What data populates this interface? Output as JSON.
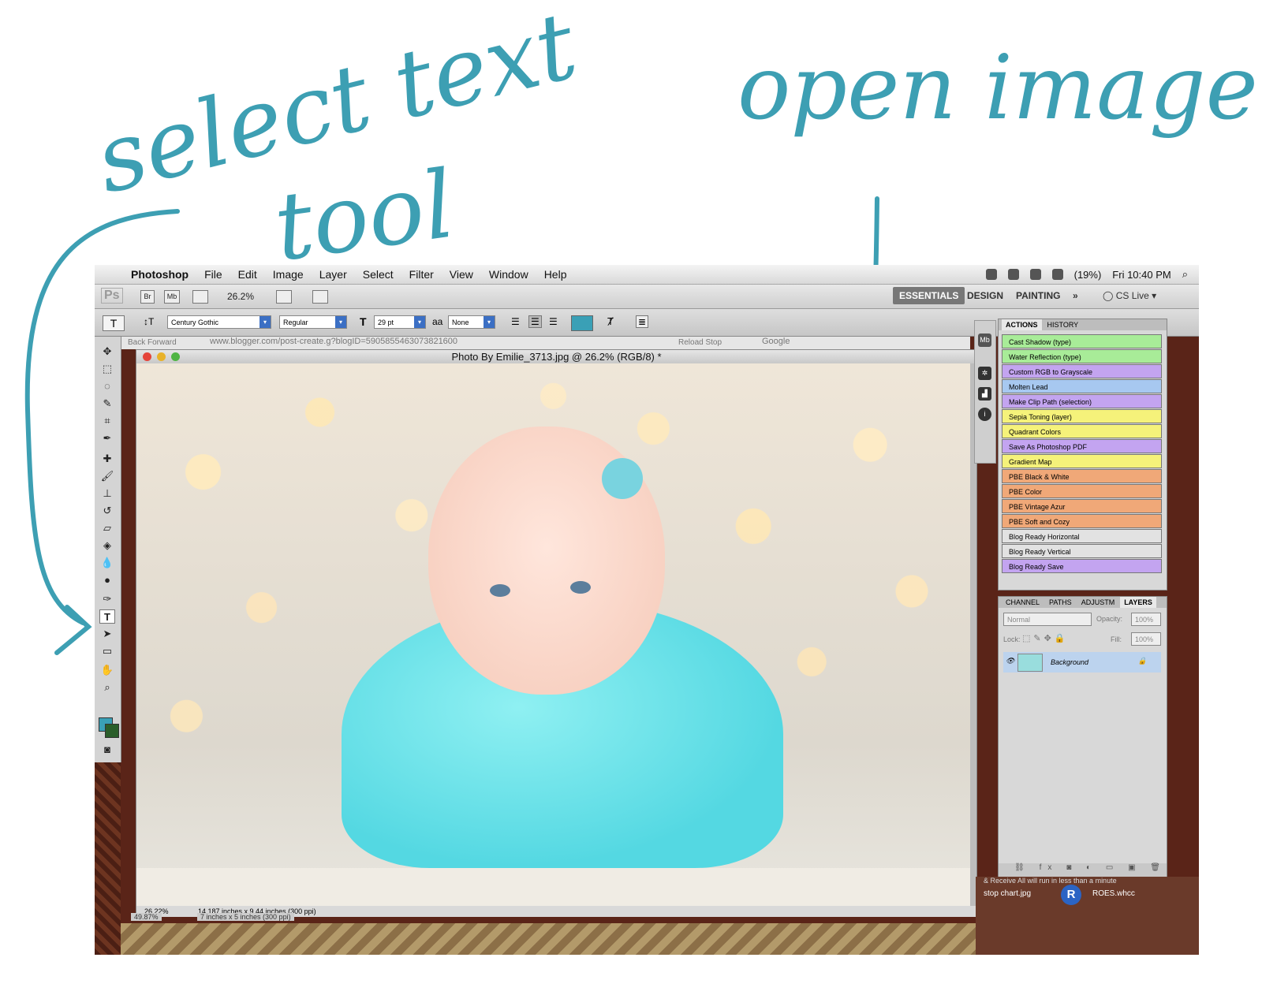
{
  "annotations": {
    "left_note_line1": "select text",
    "left_note_line2": "tool",
    "right_note": "open image"
  },
  "menubar": {
    "app_name": "Photoshop",
    "items": [
      "File",
      "Edit",
      "Image",
      "Layer",
      "Select",
      "Filter",
      "View",
      "Window",
      "Help"
    ],
    "battery": "(19%)",
    "clock": "Fri 10:40 PM"
  },
  "appbar": {
    "zoom": "26.2%",
    "workspaces": [
      "ESSENTIALS",
      "DESIGN",
      "PAINTING"
    ],
    "more": "»",
    "cs_live": "CS Live"
  },
  "options": {
    "font_family": "Century Gothic",
    "font_style": "Regular",
    "font_size": "29 pt",
    "antialias": "None",
    "text_color": "#3aa0b6"
  },
  "browser": {
    "back_forward": "Back   Forward",
    "url": "www.blogger.com/post-create.g?blogID=5905855463073821600",
    "reload_stop": "Reload   Stop",
    "search": "Google"
  },
  "document": {
    "title": "Photo By Emilie_3713.jpg @ 26.2% (RGB/8) *",
    "status_zoom": "26.22%",
    "status_info": "14.187 inches x 9.44 inches (300 ppi)",
    "behind_zoom": "49.87%",
    "behind_info": "7 inches x 5 inches (300 ppi)"
  },
  "actions_panel": {
    "tabs": [
      "ACTIONS",
      "HISTORY"
    ],
    "items": [
      {
        "label": "Cast Shadow (type)",
        "color": "#a8ec98"
      },
      {
        "label": "Water Reflection (type)",
        "color": "#a8ec98"
      },
      {
        "label": "Custom RGB to Grayscale",
        "color": "#c3a4f0"
      },
      {
        "label": "Molten Lead",
        "color": "#a7c8f0"
      },
      {
        "label": "Make Clip Path (selection)",
        "color": "#c3a4f0"
      },
      {
        "label": "Sepia Toning (layer)",
        "color": "#f5f27a"
      },
      {
        "label": "Quadrant Colors",
        "color": "#f5f27a"
      },
      {
        "label": "Save As Photoshop PDF",
        "color": "#c3a4f0"
      },
      {
        "label": "Gradient Map",
        "color": "#f5f27a"
      },
      {
        "label": "PBE Black & White",
        "color": "#f0a878"
      },
      {
        "label": "PBE Color",
        "color": "#f0a878"
      },
      {
        "label": "PBE Vintage Azur",
        "color": "#f0a878"
      },
      {
        "label": "PBE Soft and Cozy",
        "color": "#f0a878"
      },
      {
        "label": "Blog Ready Horizontal",
        "color": "#e2e2e2"
      },
      {
        "label": "Blog Ready Vertical",
        "color": "#e2e2e2"
      },
      {
        "label": "Blog Ready Save",
        "color": "#c3a4f0"
      }
    ]
  },
  "layers_panel": {
    "tabs": [
      "CHANNEL",
      "PATHS",
      "ADJUSTM",
      "LAYERS"
    ],
    "blend_mode": "Normal",
    "opacity_label": "Opacity:",
    "opacity": "100%",
    "lock_label": "Lock:",
    "fill_label": "Fill:",
    "fill": "100%",
    "layer_name": "Background"
  },
  "desktop": {
    "file1": "stop chart.jpg",
    "file2": "ROES.whcc",
    "r_logo": "R",
    "bg_text": "& Receive All  will run in less than a minute"
  }
}
